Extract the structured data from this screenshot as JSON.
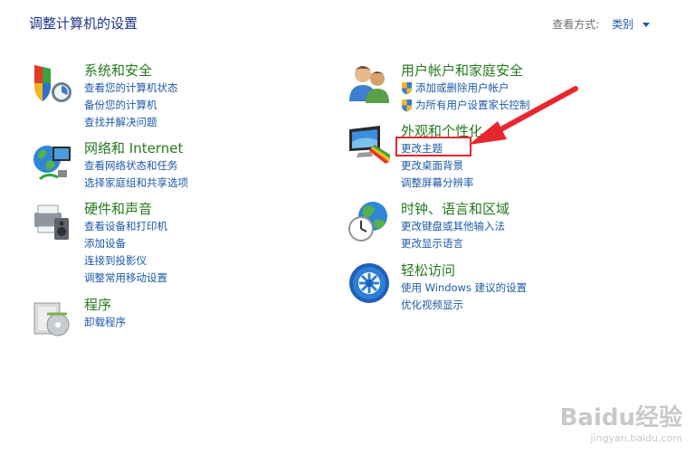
{
  "page_title": "调整计算机的设置",
  "view_by": {
    "label": "查看方式:",
    "value": "类别"
  },
  "categories": [
    {
      "id": "system",
      "title": "系统和安全",
      "icon": "system-security-icon",
      "links": [
        "查看您的计算机状态",
        "备份您的计算机",
        "查找并解决问题"
      ]
    },
    {
      "id": "network",
      "title": "网络和 Internet",
      "icon": "network-internet-icon",
      "links": [
        "查看网络状态和任务",
        "选择家庭组和共享选项"
      ]
    },
    {
      "id": "hardware",
      "title": "硬件和声音",
      "icon": "hardware-sound-icon",
      "links": [
        "查看设备和打印机",
        "添加设备",
        "连接到投影仪",
        "调整常用移动设置"
      ]
    },
    {
      "id": "programs",
      "title": "程序",
      "icon": "programs-icon",
      "links": [
        "卸载程序"
      ]
    },
    {
      "id": "users",
      "title": "用户帐户和家庭安全",
      "icon": "user-accounts-icon",
      "links": [
        "添加或删除用户帐户",
        "为所有用户设置家长控制"
      ]
    },
    {
      "id": "appearance",
      "title": "外观和个性化",
      "icon": "appearance-icon",
      "links": [
        "更改主题",
        "更改桌面背景",
        "调整屏幕分辨率"
      ]
    },
    {
      "id": "clock",
      "title": "时钟、语言和区域",
      "icon": "clock-region-icon",
      "links": [
        "更改键盘或其他输入法",
        "更改显示语言"
      ]
    },
    {
      "id": "ease",
      "title": "轻松访问",
      "icon": "ease-of-access-icon",
      "links": [
        "使用 Windows 建议的设置",
        "优化视频显示"
      ]
    }
  ],
  "annotation": {
    "highlight_color": "#e8262d"
  },
  "watermark": {
    "brand": "Baidu经验",
    "url": "jingyan.baidu.com"
  }
}
